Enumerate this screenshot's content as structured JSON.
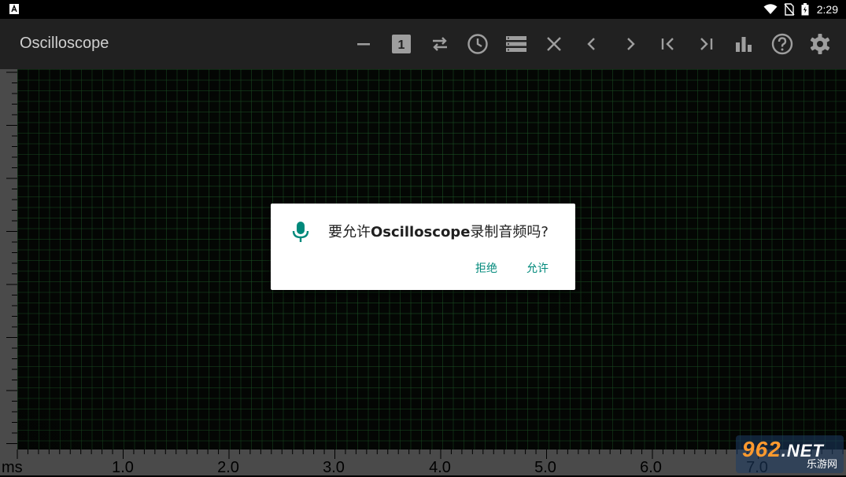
{
  "status_bar": {
    "time": "2:29",
    "icons": [
      "notification-icon",
      "wifi-icon",
      "no-sim-icon",
      "battery-icon"
    ]
  },
  "app_bar": {
    "title": "Oscilloscope",
    "channel_number": "1",
    "actions": [
      "minus-icon",
      "channel-1-icon",
      "swap-icon",
      "clock-icon",
      "menu-list-icon",
      "close-icon",
      "prev-icon",
      "next-icon",
      "first-icon",
      "last-icon",
      "bar-chart-icon",
      "help-icon",
      "settings-icon"
    ]
  },
  "scope": {
    "x_unit": "ms",
    "x_ticks": [
      "1.0",
      "2.0",
      "3.0",
      "4.0",
      "5.0",
      "6.0",
      "7.0"
    ]
  },
  "dialog": {
    "prefix": "要允许",
    "app_name": "Oscilloscope",
    "suffix": "录制音频吗?",
    "deny_label": "拒绝",
    "allow_label": "允许",
    "accent_color": "#00897b"
  },
  "watermark": {
    "brand": "962",
    "domain": ".NET",
    "tagline": "乐游网"
  }
}
